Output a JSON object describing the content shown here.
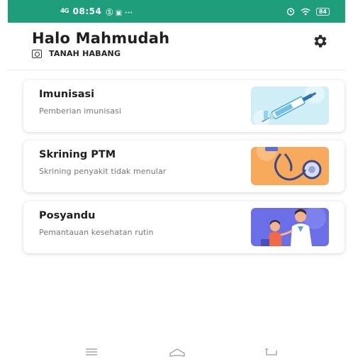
{
  "status_bar": {
    "signal": "4G",
    "time": "08:54",
    "icons": "Ⓢ ▣ ···",
    "battery": "84"
  },
  "header": {
    "greeting": "Halo Mahmudah",
    "location": "TANAH HABANG",
    "settings_icon": "gear-icon"
  },
  "cards": [
    {
      "title": "Imunisasi",
      "subtitle": "Pemberian imunisasi",
      "illustration": "vaccine-syringe"
    },
    {
      "title": "Skrining PTM",
      "subtitle": "Skrining penyakit tidak menular",
      "illustration": "stethoscope"
    },
    {
      "title": "Posyandu",
      "subtitle": "Pemantauan kesehatan rutin",
      "illustration": "doctor-child"
    }
  ],
  "nav_bar": {
    "items": [
      "menu-icon",
      "home-icon",
      "back-icon"
    ]
  },
  "colors": {
    "status_bar": "#1f9e7c",
    "title": "#1f1f1f",
    "subtitle": "#777777",
    "imunisasi_bg": "#cfeef6",
    "ptm_bg": "#f7a95c",
    "posyandu_bg": "#6a6fe8"
  }
}
